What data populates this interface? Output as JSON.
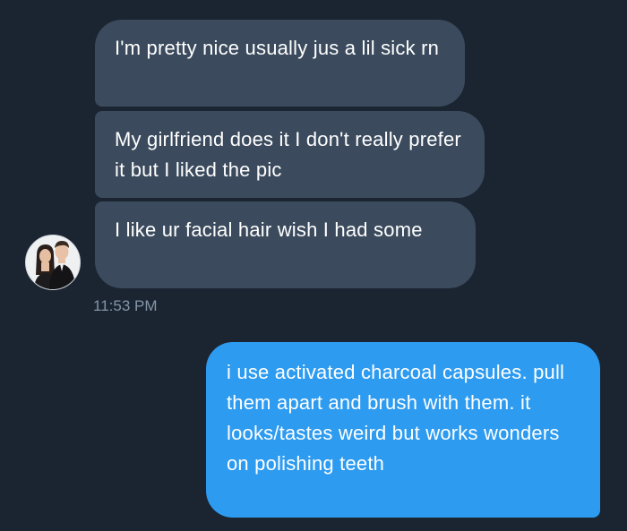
{
  "conversation": {
    "incoming": [
      {
        "text": "I'm pretty nice usually jus a lil sick rn"
      },
      {
        "text": "My girlfriend does it I don't really prefer it but I liked the pic"
      },
      {
        "text": "I like ur facial hair wish I had some"
      }
    ],
    "timestamp": "11:53 PM",
    "outgoing": [
      {
        "text": "i use activated charcoal capsules. pull them apart and brush with them. it looks/tastes weird but works wonders on polishing teeth"
      }
    ]
  },
  "avatar": {
    "icon": "profile-photo-couple"
  },
  "colors": {
    "background": "#1b2532",
    "incoming_bubble": "#3b4b5d",
    "outgoing_bubble": "#2d9bf0",
    "timestamp": "#8495a6",
    "text": "#ffffff"
  }
}
